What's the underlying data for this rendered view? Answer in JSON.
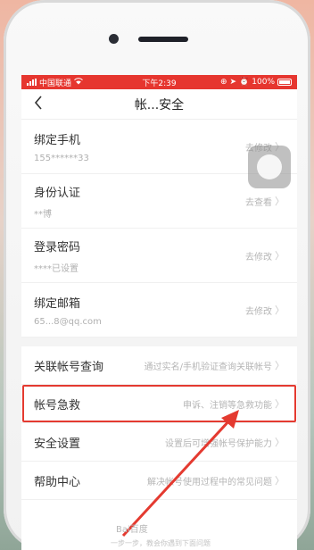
{
  "status_bar": {
    "carrier": "中国联通",
    "time": "下午2:39",
    "battery": "100%"
  },
  "nav": {
    "title": "帐...安全"
  },
  "account_rows": [
    {
      "label": "绑定手机",
      "value": "155******33",
      "action": "去修改"
    },
    {
      "label": "身份认证",
      "value": "**博",
      "action": "去查看"
    },
    {
      "label": "登录密码",
      "value": "****已设置",
      "action": "去修改"
    },
    {
      "label": "绑定邮箱",
      "value": "65...8@qq.com",
      "action": "去修改"
    }
  ],
  "menu_rows": [
    {
      "label": "关联帐号查询",
      "hint": "通过实名/手机验证查询关联帐号"
    },
    {
      "label": "帐号急救",
      "hint": "申诉、注销等急救功能"
    },
    {
      "label": "安全设置",
      "hint": "设置后可增强帐号保护能力"
    },
    {
      "label": "帮助中心",
      "hint": "解决帐号使用过程中的常见问题"
    }
  ],
  "watermark": {
    "brand": "Bai百度",
    "caption": "一步一步，教会你遇到下面问题"
  },
  "colors": {
    "accent": "#e6362f",
    "highlight": "#e43a30"
  }
}
